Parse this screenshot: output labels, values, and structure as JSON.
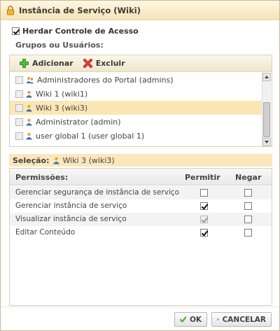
{
  "dialog": {
    "title": "Instância de Serviço (Wiki)"
  },
  "inherit": {
    "label": "Herdar Controle de Acesso",
    "checked": true
  },
  "groups": {
    "section_label": "Grupos ou Usuários:",
    "add_label": "Adicionar",
    "remove_label": "Excluir",
    "items": [
      {
        "label": "Administradores do Portal (admins)",
        "icon": "group-icon",
        "selected": false
      },
      {
        "label": "Wiki 1 (wiki1)",
        "icon": "user-icon",
        "selected": false
      },
      {
        "label": "Wiki 3 (wiki3)",
        "icon": "user-icon",
        "selected": true
      },
      {
        "label": "Administrator (admin)",
        "icon": "user-icon",
        "selected": false
      },
      {
        "label": "user global 1 (user global 1)",
        "icon": "user-icon",
        "selected": false
      }
    ]
  },
  "selection": {
    "label": "Seleção:",
    "value": "Wiki 3 (wiki3)"
  },
  "permissions": {
    "header_name": "Permissões:",
    "header_allow": "Permitir",
    "header_deny": "Negar",
    "rows": [
      {
        "name": "Gerenciar segurança de instância de serviço",
        "allow": false,
        "allow_disabled": false,
        "deny": false
      },
      {
        "name": "Gerenciar instância de serviço",
        "allow": true,
        "allow_disabled": false,
        "deny": false
      },
      {
        "name": "Visualizar instância de serviço",
        "allow": true,
        "allow_disabled": true,
        "deny": false
      },
      {
        "name": "Editar Conteúdo",
        "allow": true,
        "allow_disabled": false,
        "deny": false
      }
    ]
  },
  "buttons": {
    "ok_label": "OK",
    "cancel_label": "CANCELAR"
  },
  "colors": {
    "title_bg": "#f6e3b8",
    "selected_row": "#fde6b6",
    "add_green": "#3aa52b",
    "remove_red": "#d9342b"
  }
}
